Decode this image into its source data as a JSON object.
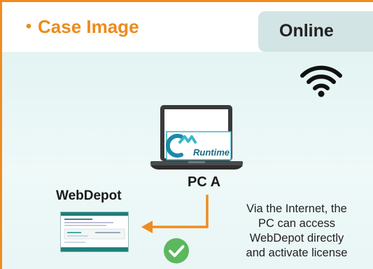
{
  "header": {
    "title": "・Case Image",
    "badge": "Online"
  },
  "diagram": {
    "pc_label": "PC A",
    "pc_screen_label": "Runtime",
    "server_label": "WebDepot",
    "description": [
      "Via the Internet, the",
      "PC can access",
      "WebDepot directly",
      "and activate license"
    ]
  },
  "colors": {
    "accent": "#f08c1e",
    "badge_bg": "#d3e4e4",
    "panel_bg": "#e6f5f4",
    "check": "#5cb85c",
    "logo_teal": "#1c8aa8"
  },
  "icons": {
    "wifi": "wifi-icon",
    "laptop": "laptop-icon",
    "check": "check-circle-icon",
    "arrow": "arrow-left-icon"
  }
}
